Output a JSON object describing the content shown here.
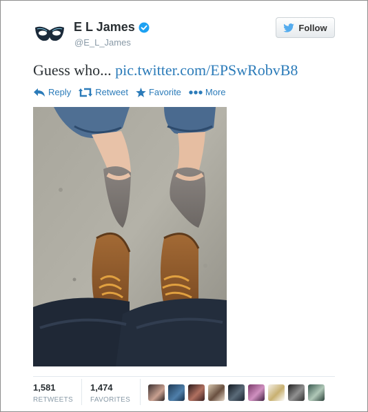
{
  "user": {
    "name": "E L James",
    "handle": "@E_L_James",
    "verified": true
  },
  "follow_button": {
    "label": "Follow"
  },
  "tweet": {
    "text": "Guess who...",
    "link": "pic.twitter.com/EPSwRobvB8"
  },
  "actions": [
    {
      "label": "Reply",
      "icon": "reply-icon"
    },
    {
      "label": "Retweet",
      "icon": "retweet-icon"
    },
    {
      "label": "Favorite",
      "icon": "star-icon"
    },
    {
      "label": "More",
      "icon": "more-dots-icon"
    }
  ],
  "stats": {
    "retweets": {
      "value": "1,581",
      "label": "RETWEETS"
    },
    "favorites": {
      "value": "1,474",
      "label": "FAVORITES"
    }
  },
  "favoriters_count_shown": 9,
  "colors": {
    "link": "#2b7bb9",
    "text": "#292f33",
    "muted": "#8899a6",
    "twitter_blue": "#55acee",
    "verified": "#1da1f2"
  }
}
